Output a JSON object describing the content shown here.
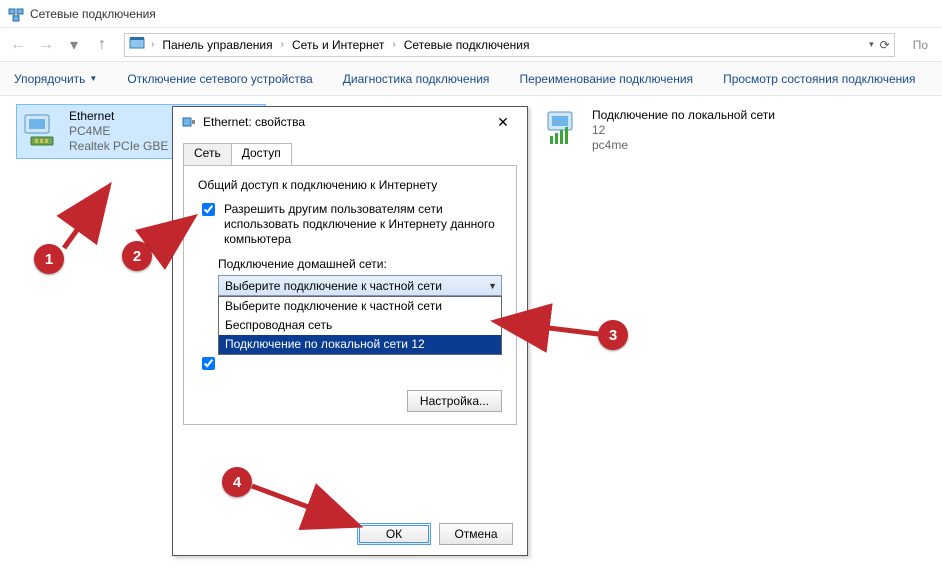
{
  "window": {
    "title": "Сетевые подключения"
  },
  "breadcrumb": {
    "seg1": "Панель управления",
    "seg2": "Сеть и Интернет",
    "seg3": "Сетевые подключения"
  },
  "search_placeholder": "По",
  "cmdbar": {
    "organize": "Упорядочить",
    "disable": "Отключение сетевого устройства",
    "diagnose": "Диагностика подключения",
    "rename": "Переименование подключения",
    "status": "Просмотр состояния подключения"
  },
  "connections": {
    "eth": {
      "name": "Ethernet",
      "line2": "PC4ME",
      "line3": "Realtek PCIe GBE"
    },
    "lan": {
      "name": "Подключение по локальной сети",
      "line2": "12",
      "line3": "pc4me"
    }
  },
  "dialog": {
    "title": "Ethernet: свойства",
    "tab_network": "Сеть",
    "tab_sharing": "Доступ",
    "group": "Общий доступ к подключению к Интернету",
    "chk1": "Разрешить другим пользователям сети использовать подключение к Интернету данного компьютера",
    "home_label": "Подключение домашней сети:",
    "combo_selected": "Выберите подключение к частной сети",
    "options": [
      "Выберите подключение к частной сети",
      "Беспроводная сеть",
      "Подключение по локальной сети 12"
    ],
    "settings_btn": "Настройка...",
    "ok": "ОК",
    "cancel": "Отмена"
  },
  "annotations": {
    "a1": "1",
    "a2": "2",
    "a3": "3",
    "a4": "4"
  }
}
